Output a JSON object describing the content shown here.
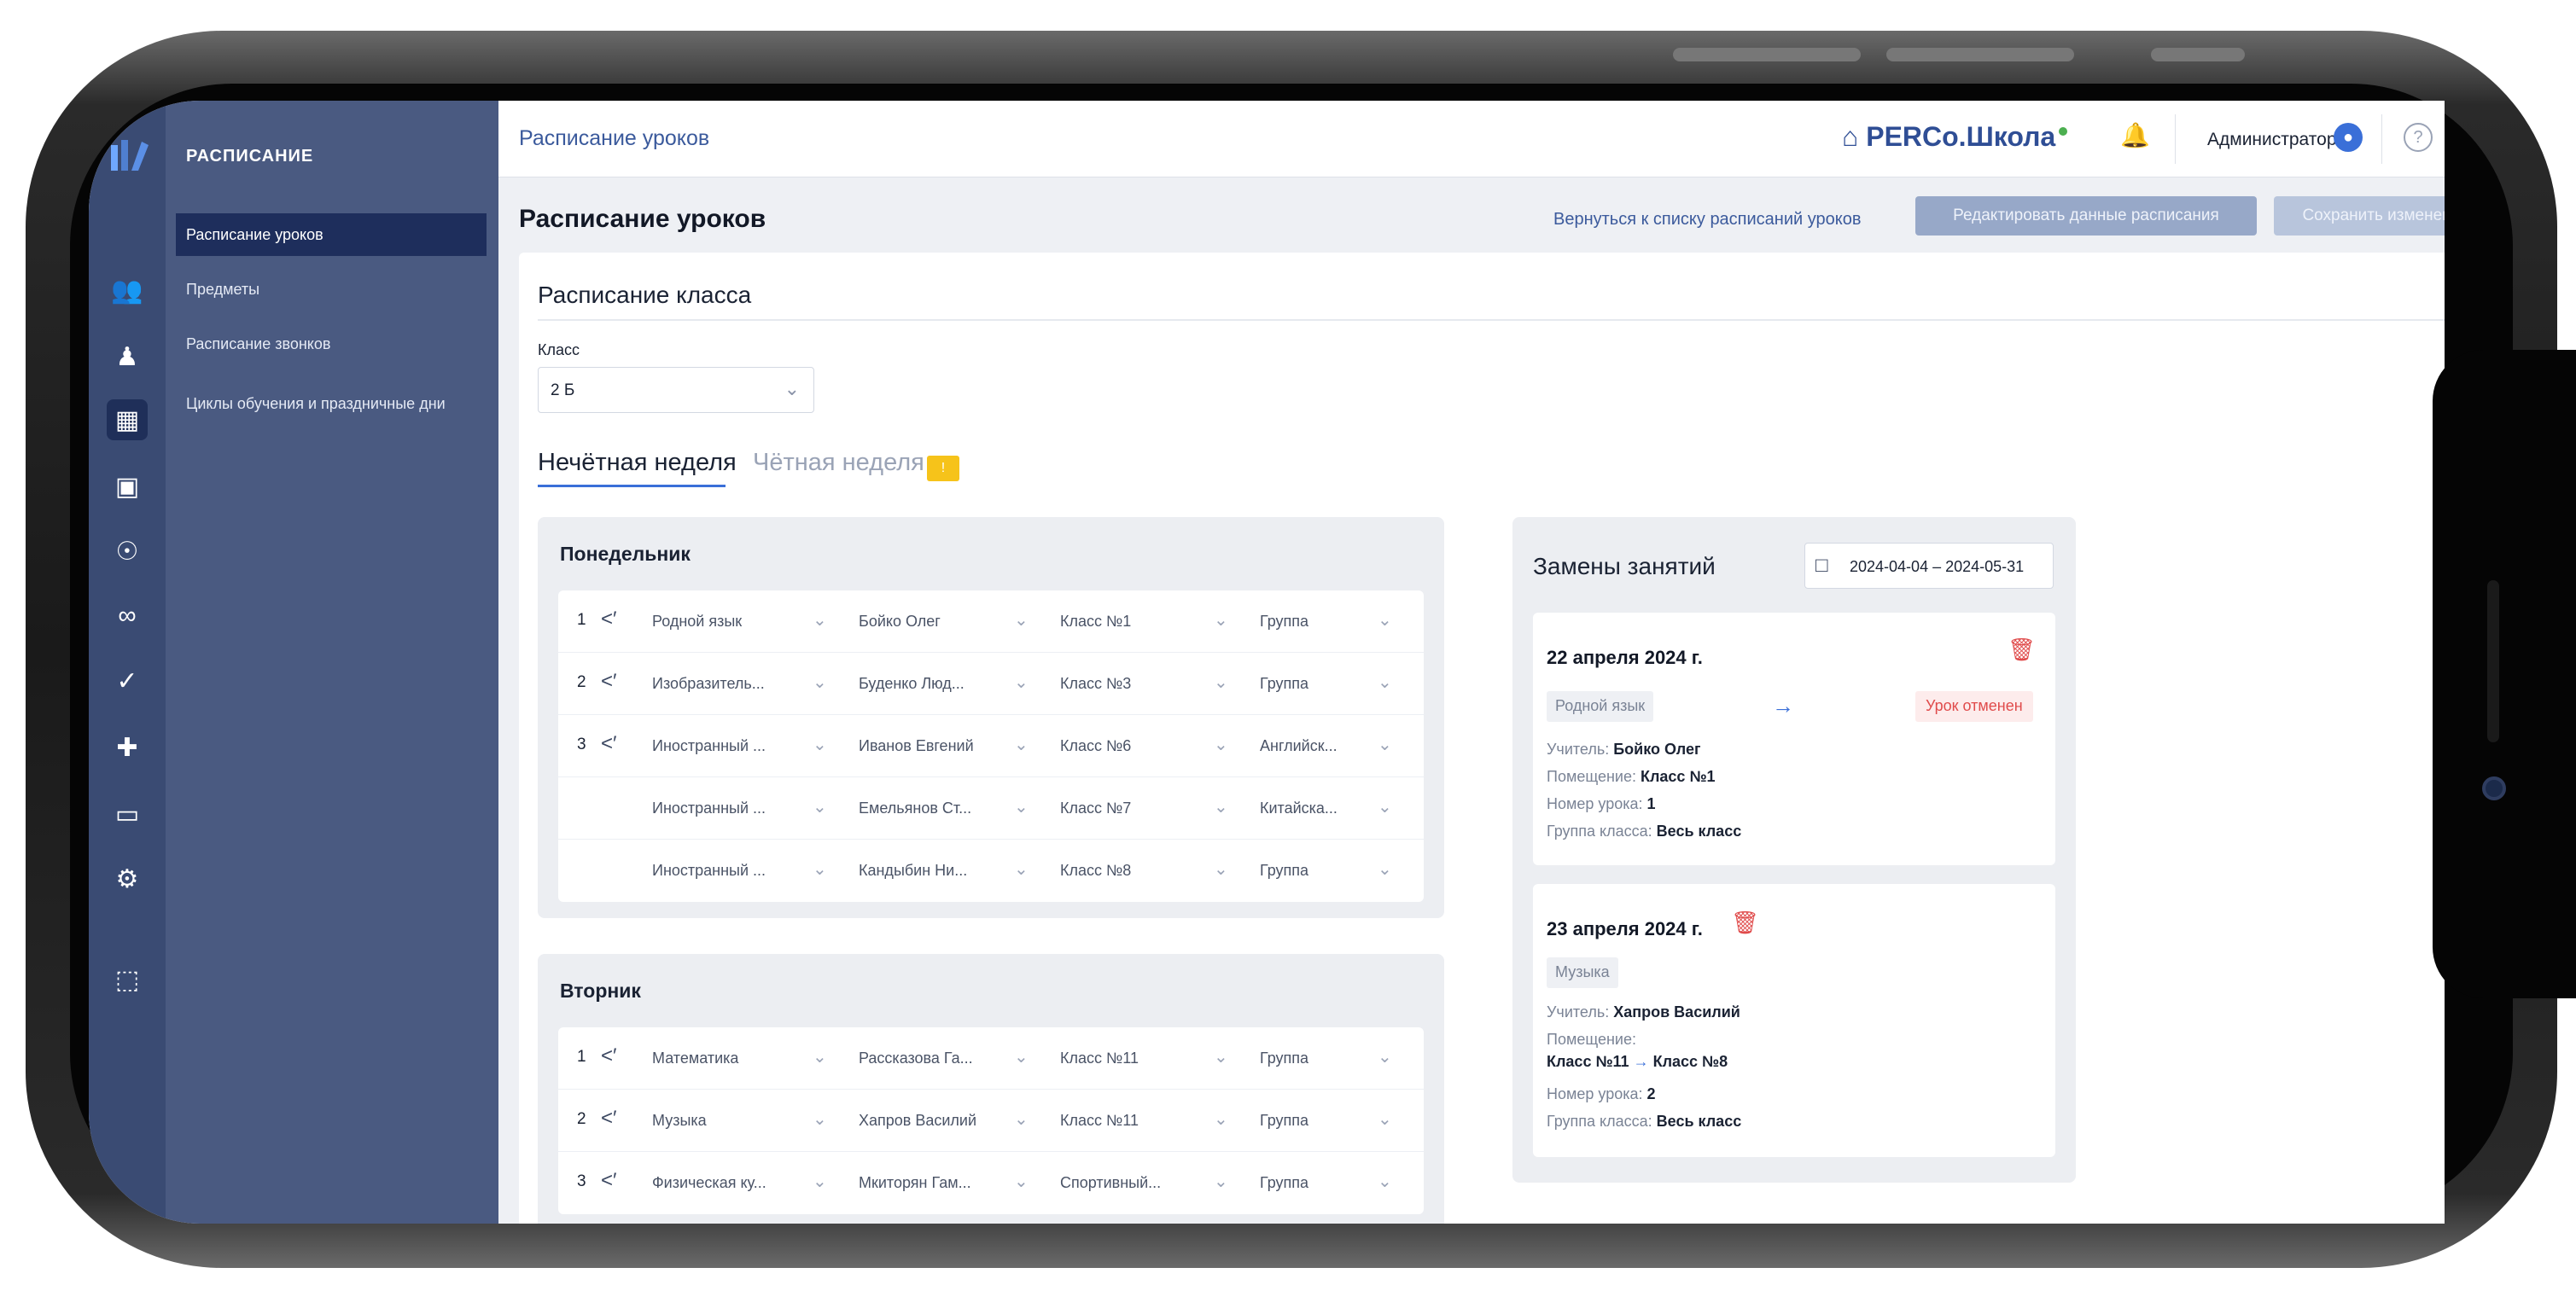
{
  "breadcrumb": "Расписание уроков",
  "brand": "PERCo.Школа",
  "user": "Администратор",
  "help_glyph": "?",
  "sidebar": {
    "section": "РАСПИСАНИЕ",
    "items": [
      {
        "label": "Расписание уроков",
        "active": true
      },
      {
        "label": "Предметы"
      },
      {
        "label": "Расписание звонков"
      },
      {
        "label": "Циклы обучения и праздничные дни"
      }
    ]
  },
  "page": {
    "title": "Расписание уроков",
    "back_link": "Вернуться к списку расписаний уроков",
    "edit_button": "Редактировать данные расписания",
    "save_button": "Сохранить изменения"
  },
  "class_schedule": {
    "title": "Расписание класса",
    "class_label": "Класс",
    "class_value": "2 Б",
    "tabs": {
      "odd": "Нечётная неделя",
      "even": "Чётная неделя",
      "badge": "!"
    }
  },
  "days": [
    {
      "name": "Понедельник",
      "rows": [
        {
          "num": "1",
          "subject": "Родной язык",
          "teacher": "Бойко Олег",
          "room": "Класс №1",
          "group": "Группа"
        },
        {
          "num": "2",
          "subject": "Изобразитель...",
          "teacher": "Буденко Люд...",
          "room": "Класс №3",
          "group": "Группа"
        },
        {
          "num": "3",
          "subject": "Иностранный ...",
          "teacher": "Иванов Евгений",
          "room": "Класс №6",
          "group": "Английск..."
        },
        {
          "num": "",
          "subject": "Иностранный ...",
          "teacher": "Емельянов Ст...",
          "room": "Класс №7",
          "group": "Китайска..."
        },
        {
          "num": "",
          "subject": "Иностранный ...",
          "teacher": "Кандыбин Ни...",
          "room": "Класс №8",
          "group": "Группа"
        }
      ]
    },
    {
      "name": "Вторник",
      "rows": [
        {
          "num": "1",
          "subject": "Математика",
          "teacher": "Рассказова Га...",
          "room": "Класс №11",
          "group": "Группа"
        },
        {
          "num": "2",
          "subject": "Музыка",
          "teacher": "Хапров Василий",
          "room": "Класс №11",
          "group": "Группа"
        },
        {
          "num": "3",
          "subject": "Физическая ку...",
          "teacher": "Мкиторян Гам...",
          "room": "Спортивный...",
          "group": "Группа"
        }
      ]
    }
  ],
  "substitutions": {
    "title": "Замены занятий",
    "date_range": "2024-04-04 – 2024-05-31",
    "items": [
      {
        "date": "22 апреля 2024 г.",
        "subject": "Родной язык",
        "status": "Урок отменен",
        "teacher_label": "Учитель:",
        "teacher": "Бойко Олег",
        "room_label": "Помещение:",
        "room": "Класс №1",
        "lesson_label": "Номер урока:",
        "lesson": "1",
        "group_label": "Группа класса:",
        "group": "Весь класс"
      },
      {
        "date": "23 апреля 2024 г.",
        "subject": "Музыка",
        "teacher_label": "Учитель:",
        "teacher": "Хапров Василий",
        "room_label": "Помещение:",
        "room_from": "Класс №11",
        "room_to": "Класс №8",
        "lesson_label": "Номер урока:",
        "lesson": "2",
        "group_label": "Группа класса:",
        "group": "Весь класс"
      }
    ]
  },
  "colors": {
    "rail": "#3a4b73",
    "sidebar": "#4a5a81",
    "active_item": "#1e2e5c",
    "accent": "#3a6fd8",
    "danger": "#e04b4b",
    "badge": "#f6c31a"
  }
}
